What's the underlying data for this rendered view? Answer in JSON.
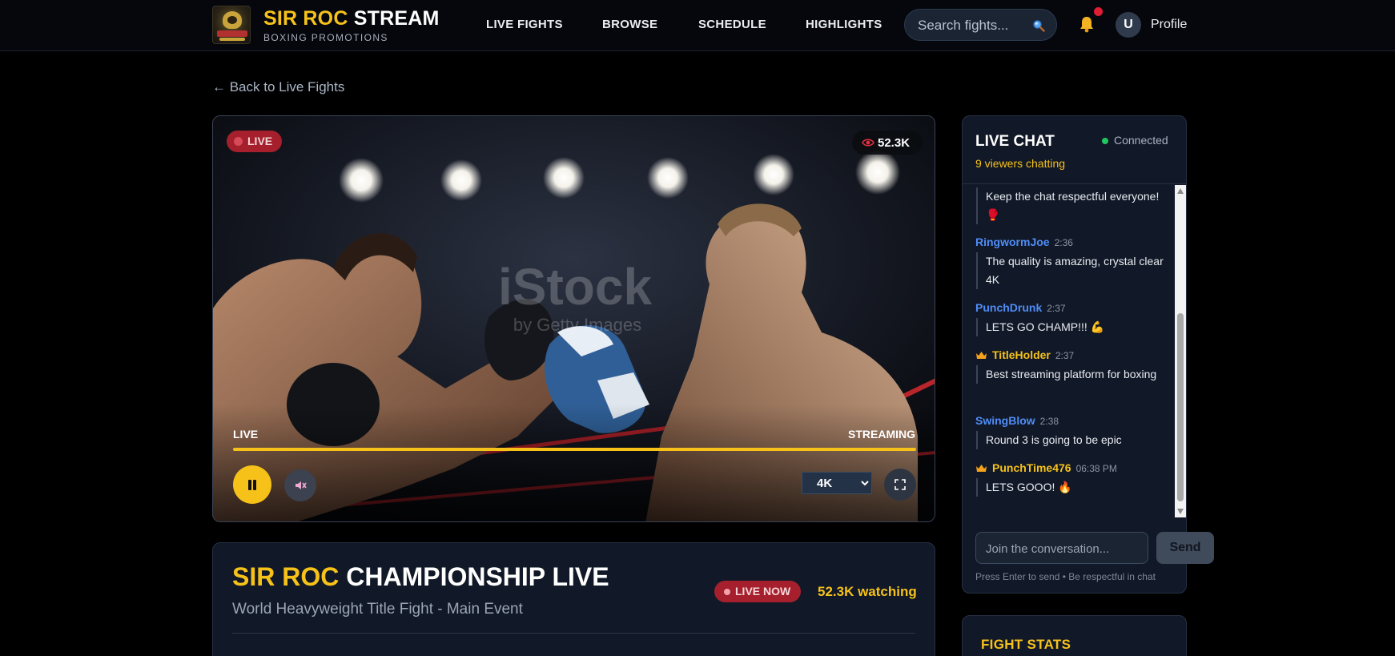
{
  "brand": {
    "title_accent": "SIR ROC",
    "title_rest": "STREAM",
    "subtitle": "BOXING PROMOTIONS"
  },
  "nav": [
    {
      "label": "LIVE FIGHTS"
    },
    {
      "label": "BROWSE"
    },
    {
      "label": "SCHEDULE"
    },
    {
      "label": "HIGHLIGHTS"
    }
  ],
  "search": {
    "placeholder": "Search fights...",
    "icon": "search-icon"
  },
  "user": {
    "avatar_letter": "U",
    "profile_label": "Profile",
    "notification_icon": "bell-icon"
  },
  "back_link": "← Back to Live Fights",
  "player": {
    "live_badge": "LIVE",
    "viewers": "52.3K",
    "watermark_line1": "iStock",
    "watermark_line2": "by Getty Images",
    "left_label": "LIVE",
    "right_label": "STREAMING",
    "progress_fraction": 1.0,
    "quality_options": [
      "4K"
    ],
    "quality_selected": "4K"
  },
  "event": {
    "title_accent": "SIR ROC",
    "title_rest": "CHAMPIONSHIP LIVE",
    "subtitle": "World Heavyweight Title Fight - Main Event",
    "status_badge": "LIVE NOW",
    "watching": "52.3K watching"
  },
  "chat": {
    "title": "LIVE CHAT",
    "status": "Connected",
    "viewers_chatting": "9 viewers chatting",
    "messages": [
      {
        "user": "",
        "time": "",
        "text": "Keep the chat respectful everyone! 🥊",
        "color": "#4f8df7",
        "vip": false
      },
      {
        "user": "RingwormJoe",
        "time": "2:36",
        "text": "The quality is amazing, crystal clear 4K",
        "color": "#4f8df7",
        "vip": false
      },
      {
        "user": "PunchDrunk",
        "time": "2:37",
        "text": "LETS GO CHAMP!!! 💪",
        "color": "#4f8df7",
        "vip": false
      },
      {
        "user": "TitleHolder",
        "time": "2:37",
        "text": "Best streaming platform for boxing",
        "color": "#f6c21a",
        "vip": true
      },
      {
        "user": "SwingBlow",
        "time": "2:38",
        "text": "Round 3 is going to be epic",
        "color": "#4f8df7",
        "vip": false
      },
      {
        "user": "PunchTime476",
        "time": "06:38 PM",
        "text": "LETS GOOO! 🔥",
        "color": "#f6c21a",
        "vip": true
      }
    ],
    "input_placeholder": "Join the conversation...",
    "send_label": "Send",
    "hint": "Press Enter to send • Be respectful in chat"
  },
  "stats": {
    "title": "FIGHT STATS"
  },
  "colors": {
    "accent": "#f6c21a",
    "live_red": "#a5202c",
    "panel": "#111827",
    "user_blue": "#4f8df7",
    "online_green": "#22c55e"
  }
}
